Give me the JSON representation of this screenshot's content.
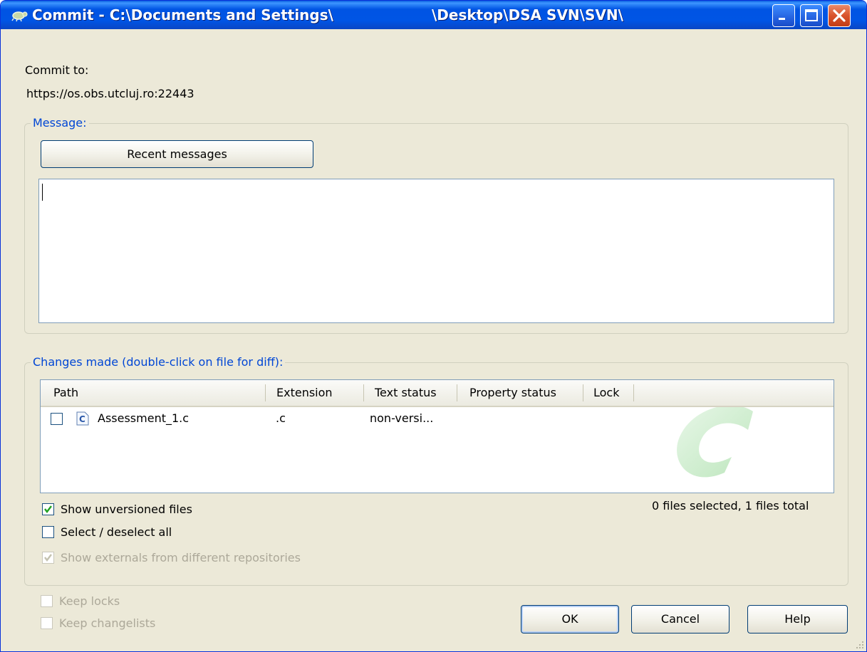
{
  "window": {
    "title_left": "Commit - C:\\Documents and Settings\\",
    "title_right": "\\Desktop\\DSA SVN\\SVN\\",
    "minimize_icon": "minimize-icon",
    "maximize_icon": "maximize-icon",
    "close_icon": "close-icon"
  },
  "commit_to": {
    "label": "Commit to:",
    "url": "https://os.obs.utcluj.ro:22443"
  },
  "message": {
    "group_label": "Message:",
    "recent_button": "Recent messages",
    "text": ""
  },
  "changes": {
    "group_label": "Changes made (double-click on file for diff):",
    "columns": [
      "Path",
      "Extension",
      "Text status",
      "Property status",
      "Lock"
    ],
    "rows": [
      {
        "checked": false,
        "icon": "c-file-icon",
        "path": "Assessment_1.c",
        "extension": ".c",
        "text_status": "non-versi...",
        "property_status": "",
        "lock": ""
      }
    ],
    "summary": "0 files selected, 1 files total"
  },
  "options": {
    "show_unversioned": {
      "label": "Show unversioned files",
      "checked": true
    },
    "select_all": {
      "label": "Select / deselect all",
      "checked": false
    },
    "show_externals": {
      "label": "Show externals from different repositories",
      "checked": true,
      "disabled": true
    },
    "keep_locks": {
      "label": "Keep locks",
      "checked": false,
      "disabled": true
    },
    "keep_changelists": {
      "label": "Keep changelists",
      "checked": false,
      "disabled": true
    }
  },
  "buttons": {
    "ok": "OK",
    "cancel": "Cancel",
    "help": "Help"
  },
  "colors": {
    "titlebar": "#0054e3",
    "dialog_bg": "#ece9d8",
    "group_title": "#0046d5",
    "checkbox_check": "#21a121"
  }
}
